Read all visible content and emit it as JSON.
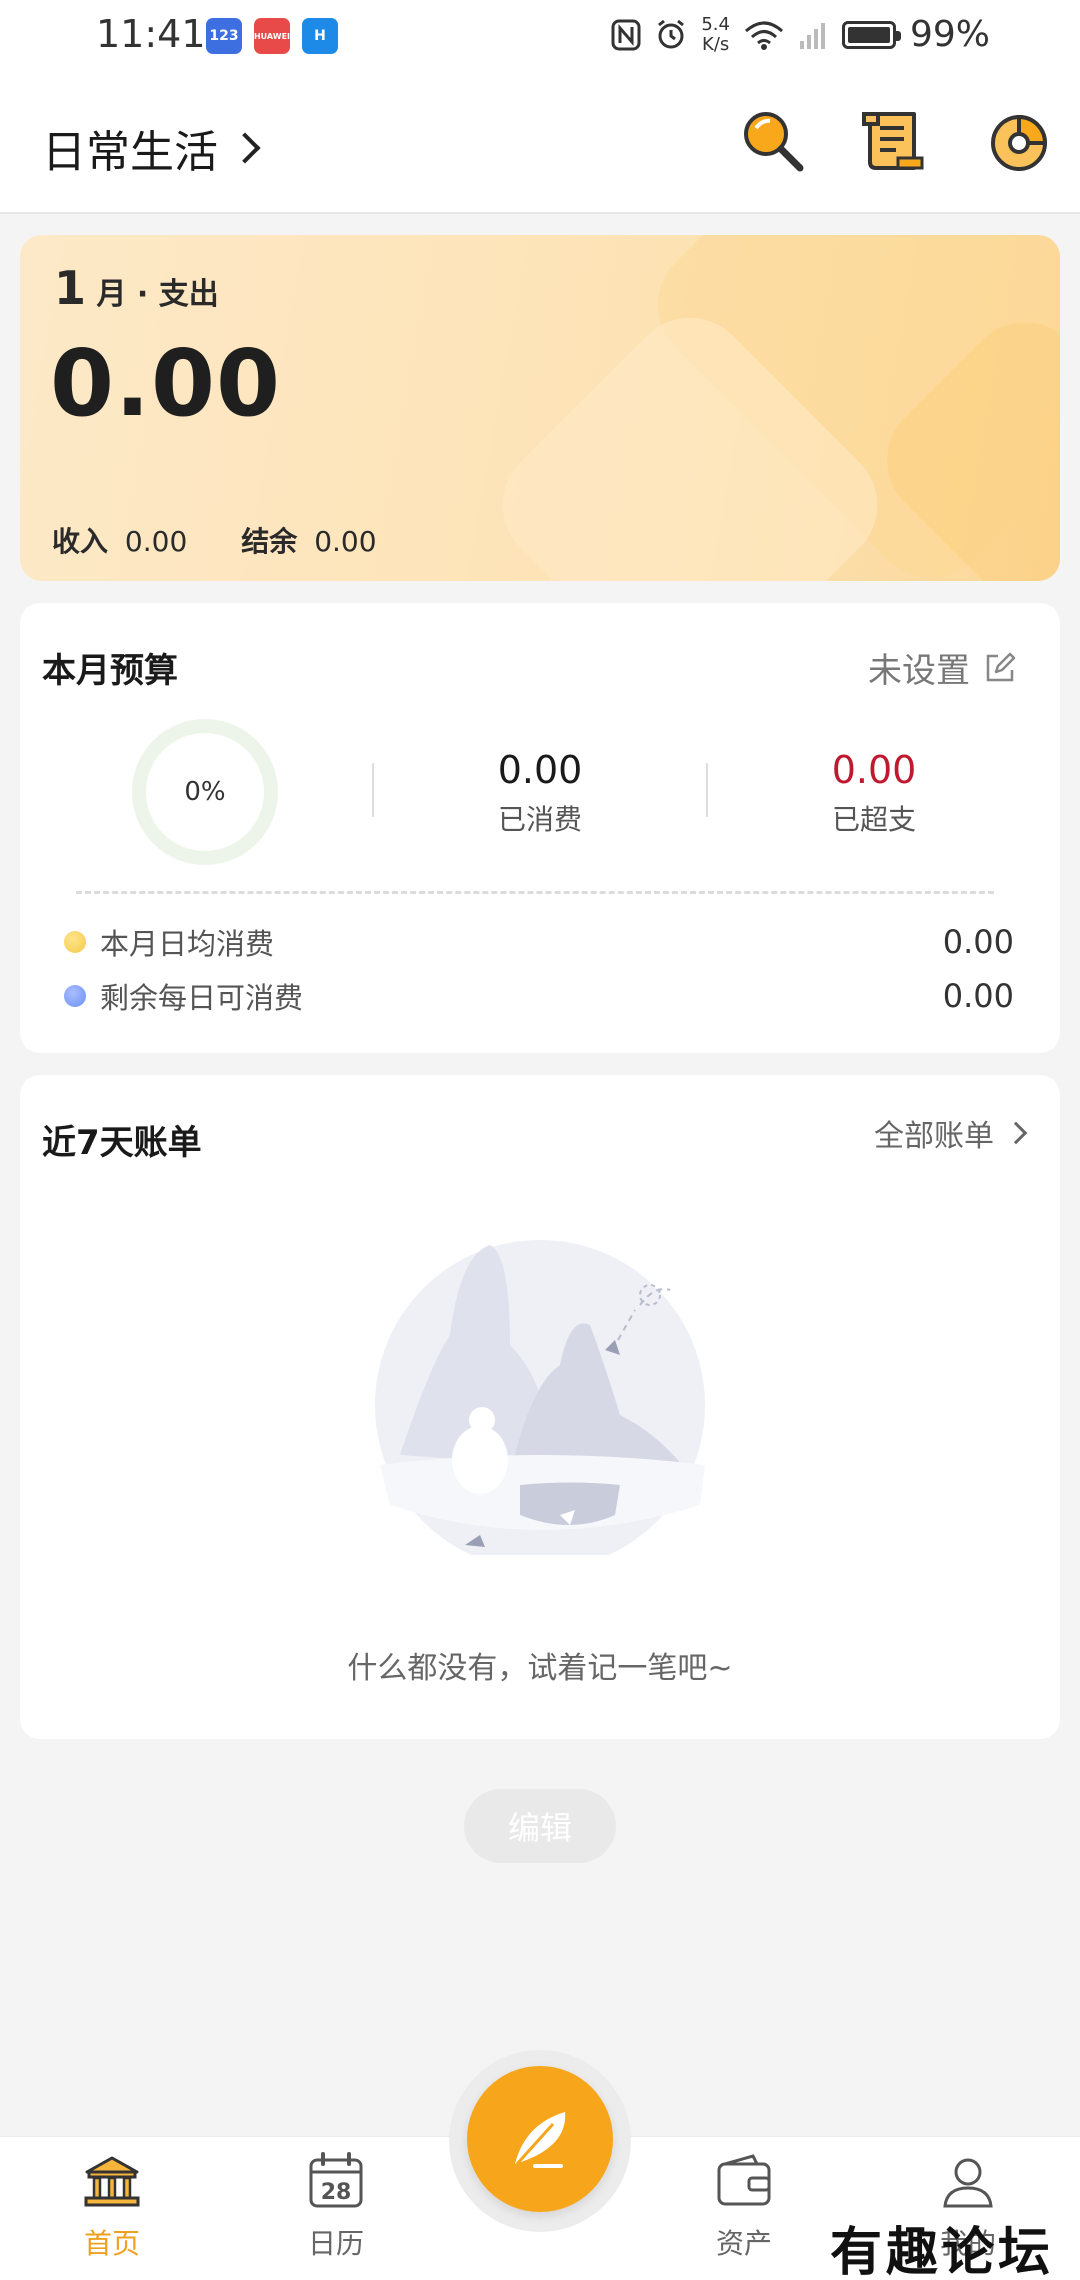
{
  "status_bar": {
    "time": "11:41",
    "apps": [
      "123",
      "HUAWEI",
      "H"
    ],
    "net_speed_value": "5.4",
    "net_speed_unit": "K/s",
    "battery_percent": "99%"
  },
  "header": {
    "book_name": "日常生活",
    "icons": [
      "search-icon",
      "bill-list-icon",
      "pie-chart-icon"
    ]
  },
  "summary": {
    "month_num": "1",
    "month_label": "月 · 支出",
    "expense": "0.00",
    "income_label": "收入",
    "income_value": "0.00",
    "balance_label": "结余",
    "balance_value": "0.00"
  },
  "budget": {
    "title": "本月预算",
    "set_label": "未设置",
    "percent": "0%",
    "spent_value": "0.00",
    "spent_label": "已消费",
    "over_value": "0.00",
    "over_label": "已超支",
    "daily_avg_label": "本月日均消费",
    "daily_avg_value": "0.00",
    "remain_daily_label": "剩余每日可消费",
    "remain_daily_value": "0.00",
    "colors": {
      "accent_over": "#c0182f",
      "dot_yellow": "#f2c94c",
      "dot_blue": "#6c8ff0"
    }
  },
  "bills": {
    "title": "近7天账单",
    "all_label": "全部账单",
    "empty_text": "什么都没有，试着记一笔吧~"
  },
  "edit_button": "编辑",
  "nav": {
    "home": "首页",
    "calendar": "日历",
    "calendar_day": "28",
    "assets": "资产",
    "mine": "我的"
  },
  "watermark": "有趣论坛",
  "colors": {
    "brand": "#f7a51a",
    "active": "#f0a020"
  }
}
